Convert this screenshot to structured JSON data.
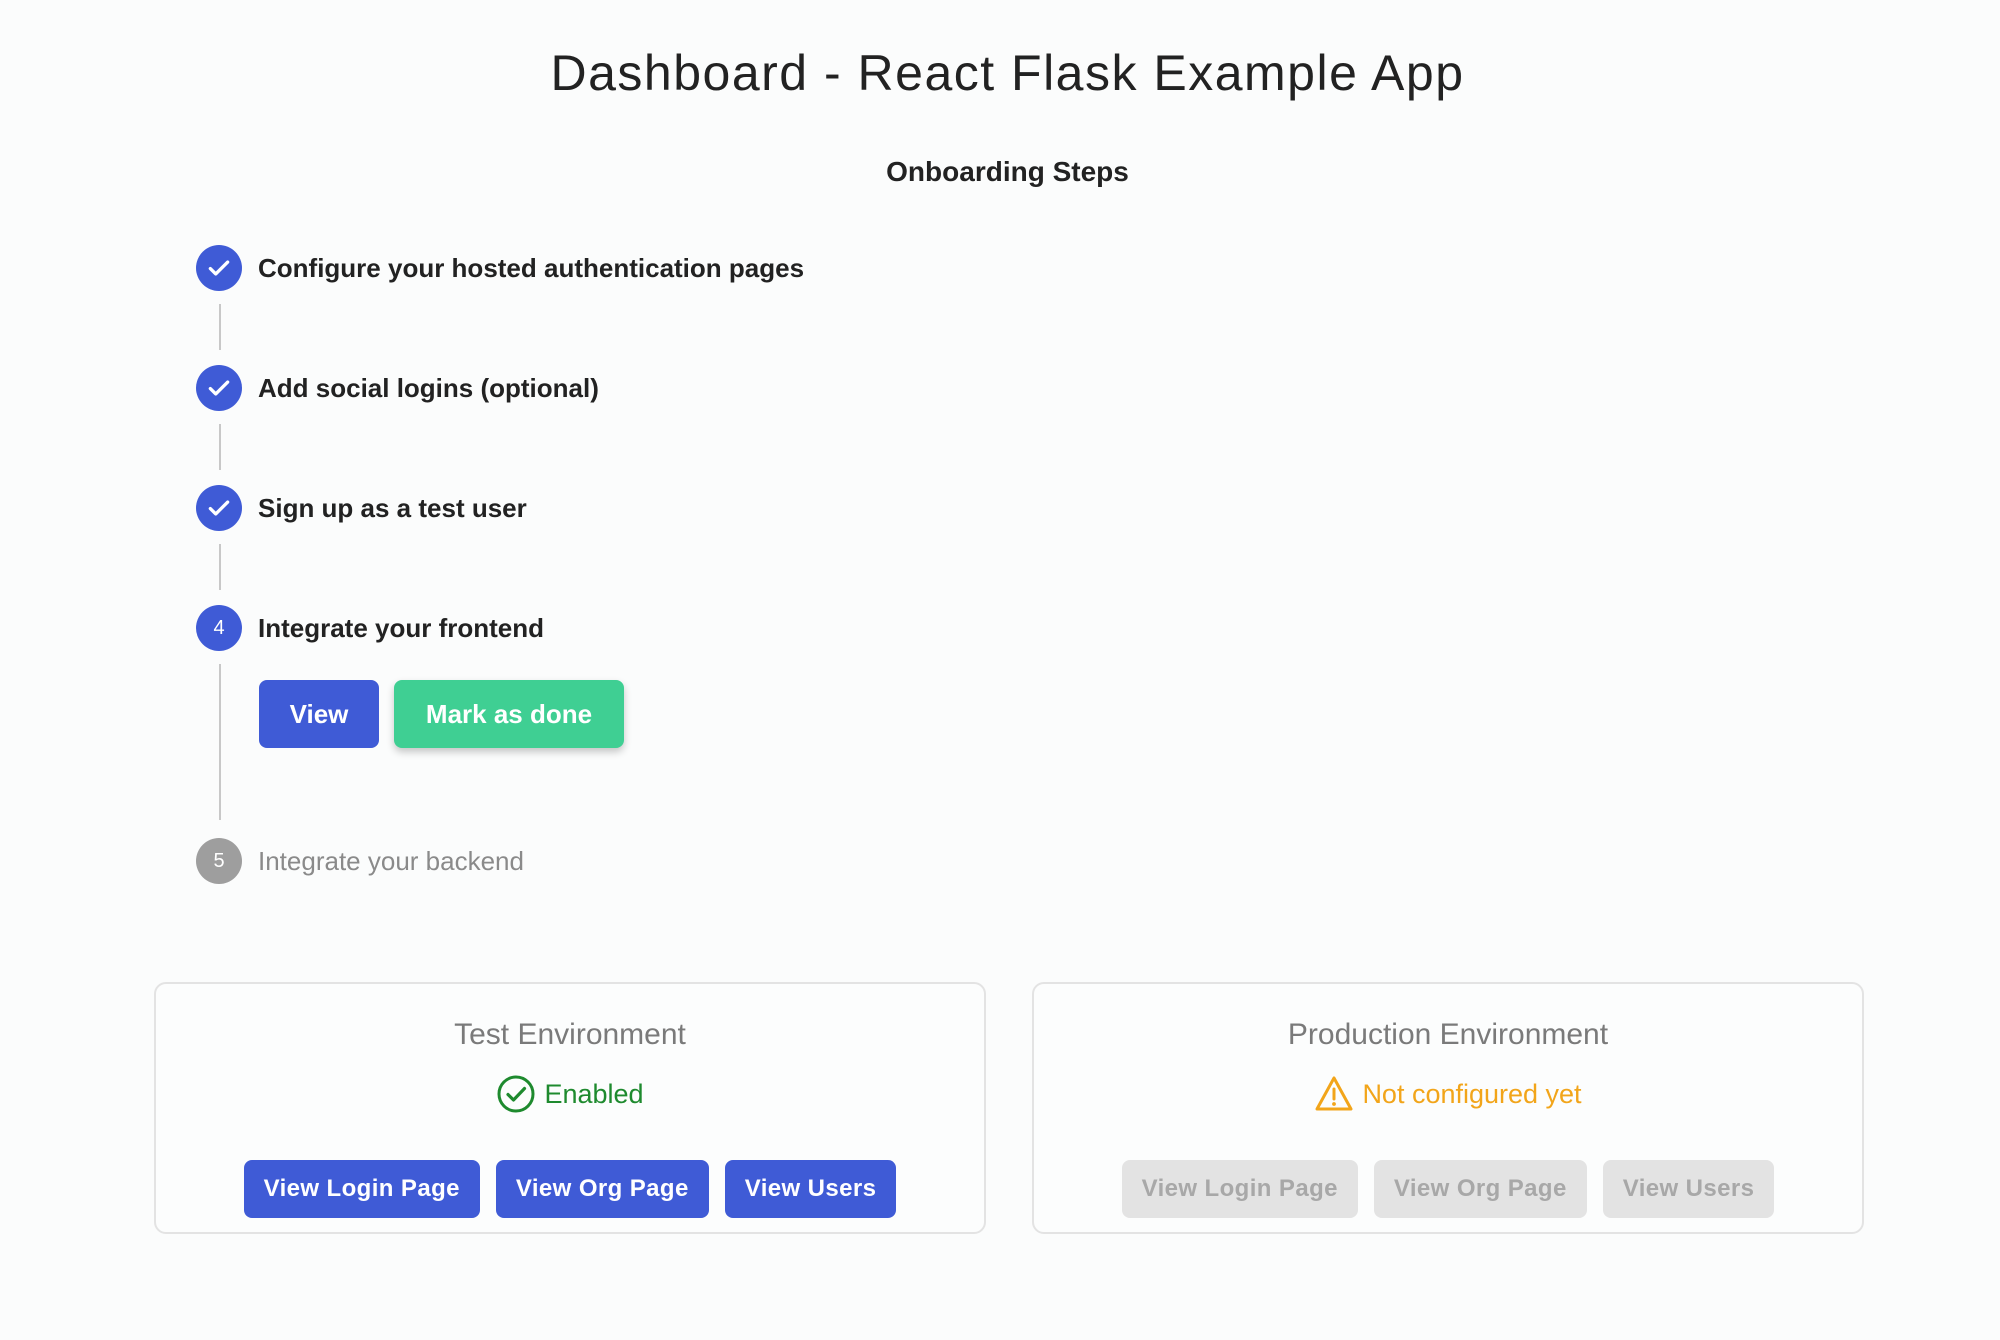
{
  "page": {
    "title": "Dashboard - React Flask Example App"
  },
  "onboarding": {
    "title": "Onboarding Steps",
    "steps": [
      {
        "number": "1",
        "label": "Configure your hosted authentication pages",
        "state": "done"
      },
      {
        "number": "2",
        "label": "Add social logins (optional)",
        "state": "done"
      },
      {
        "number": "3",
        "label": "Sign up as a test user",
        "state": "done"
      },
      {
        "number": "4",
        "label": "Integrate your frontend",
        "state": "active"
      },
      {
        "number": "5",
        "label": "Integrate your backend",
        "state": "pending"
      }
    ],
    "actions": {
      "view_label": "View",
      "mark_done_label": "Mark as done"
    }
  },
  "environments": {
    "test": {
      "title": "Test Environment",
      "status": "Enabled",
      "status_icon": "check-circle-icon",
      "status_color": "#1e8a2e",
      "buttons": [
        "View Login Page",
        "View Org Page",
        "View Users"
      ],
      "buttons_enabled": true
    },
    "production": {
      "title": "Production Environment",
      "status": "Not configured yet",
      "status_icon": "warning-triangle-icon",
      "status_color": "#f2a51a",
      "buttons": [
        "View Login Page",
        "View Org Page",
        "View Users"
      ],
      "buttons_enabled": false
    }
  },
  "colors": {
    "primary": "#3f5bd6",
    "success": "#3fcf93",
    "pending": "#9e9e9e"
  }
}
